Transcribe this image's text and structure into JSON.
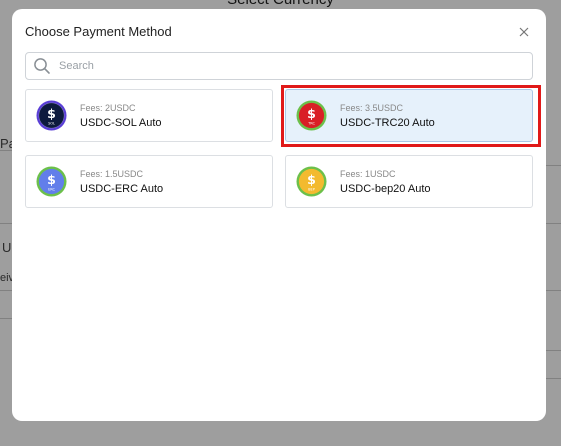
{
  "background": {
    "title": "Select Currency",
    "fragment_pa": "Pa",
    "fragment_u": "U",
    "fragment_eiv": "eiv"
  },
  "modal": {
    "title": "Choose Payment Method",
    "close_icon": "close-icon",
    "search": {
      "placeholder": "Search",
      "value": "",
      "icon": "search-icon"
    },
    "methods": [
      {
        "fees": "Fees: 2USDC",
        "name": "USDC-SOL Auto",
        "coin_label": "SOL",
        "coin_color": "#0d1a3e",
        "ring_color": "#5a3fd6",
        "selected": false
      },
      {
        "fees": "Fees: 3.5USDC",
        "name": "USDC-TRC20 Auto",
        "coin_label": "TRC",
        "coin_color": "#d91f26",
        "ring_color": "#6cc04a",
        "selected": true
      },
      {
        "fees": "Fees: 1.5USDC",
        "name": "USDC-ERC Auto",
        "coin_label": "ERC",
        "coin_color": "#627eea",
        "ring_color": "#6cc04a",
        "selected": false
      },
      {
        "fees": "Fees: 1USDC",
        "name": "USDC-bep20 Auto",
        "coin_label": "BEP",
        "coin_color": "#f3ba2f",
        "ring_color": "#6cc04a",
        "selected": false
      }
    ]
  },
  "colors": {
    "highlight": "#e01919",
    "selected_bg": "#e6f1fb"
  }
}
